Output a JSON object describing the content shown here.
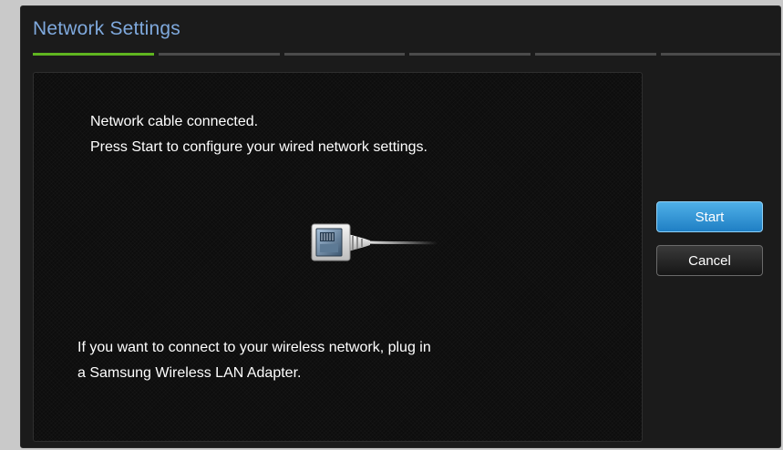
{
  "window": {
    "title": "Network Settings"
  },
  "progress": {
    "total_steps": 6,
    "current_step": 1,
    "active_color": "#5fb520",
    "inactive_color": "#4b4b4b"
  },
  "message": {
    "line1": "Network cable connected.",
    "line2": "Press Start to configure your wired network settings.",
    "wireless_line1": "If you want to connect to your wireless network, plug in",
    "wireless_line2": "a Samsung Wireless LAN Adapter."
  },
  "illustration": {
    "icon": "ethernet-cable-connector-icon"
  },
  "buttons": {
    "start_label": "Start",
    "cancel_label": "Cancel"
  },
  "colors": {
    "title": "#7fa9dd",
    "start_button": "#2a8ed0"
  }
}
